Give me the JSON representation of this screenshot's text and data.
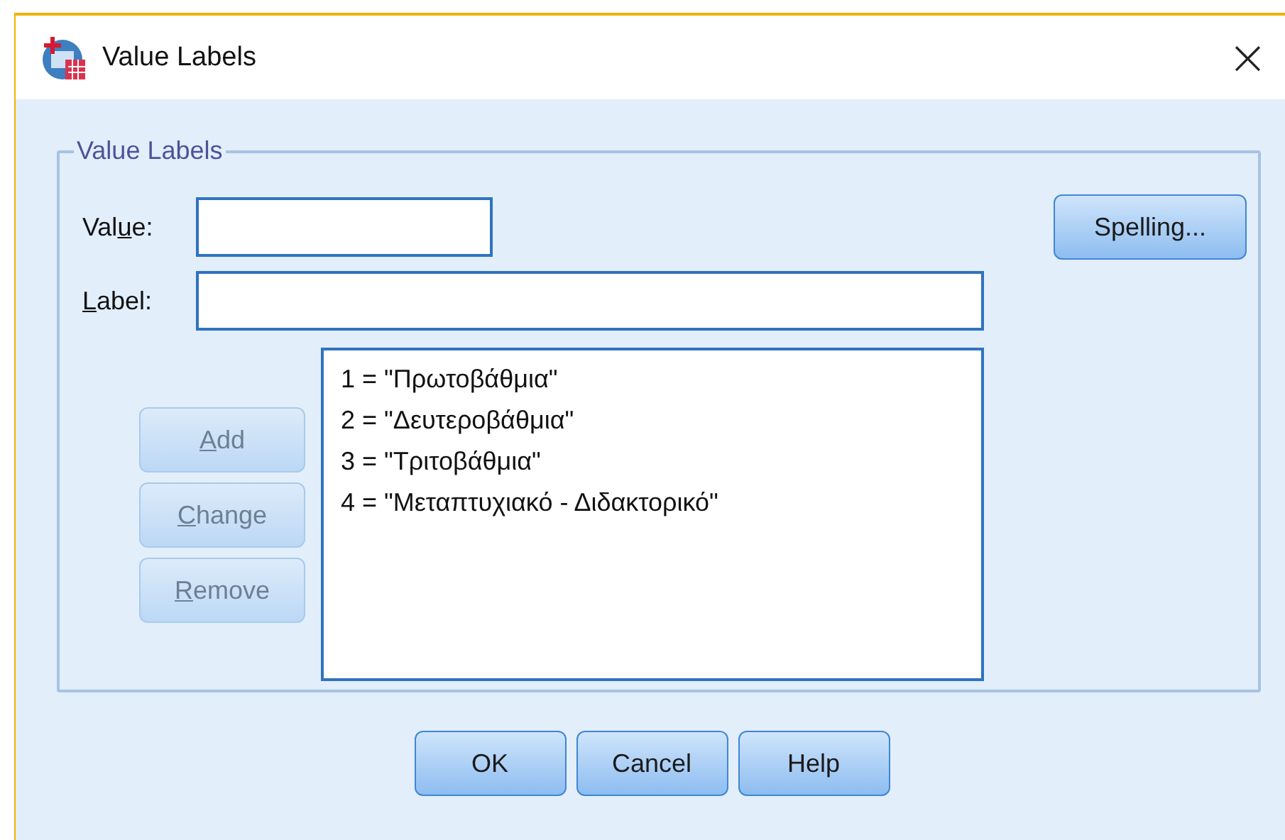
{
  "window": {
    "title": "Value Labels",
    "close": "×"
  },
  "group": {
    "legend": "Value Labels",
    "fields": [
      {
        "pre": "Val",
        "key": "u",
        "post": "e:"
      },
      {
        "key": "L",
        "post": "abel:"
      }
    ],
    "spelling": {
      "label": "Spelling...",
      "disabled": false
    },
    "actions": [
      {
        "key": "A",
        "post": "dd",
        "disabled": true
      },
      {
        "key": "C",
        "post": "hange",
        "disabled": true
      },
      {
        "key": "R",
        "post": "emove",
        "disabled": true
      }
    ],
    "items": [
      "1 = \"Πρωτοβάθμια\"",
      "2 = \"Δευτεροβάθμια\"",
      "3 = \"Τριτοβάθμια\"",
      "4 = \"Μεταπτυχιακό - Διδακτορικό\""
    ]
  },
  "buttons": [
    {
      "label": "OK",
      "disabled": false
    },
    {
      "label": "Cancel",
      "disabled": false
    },
    {
      "label": "Help",
      "disabled": false
    }
  ]
}
